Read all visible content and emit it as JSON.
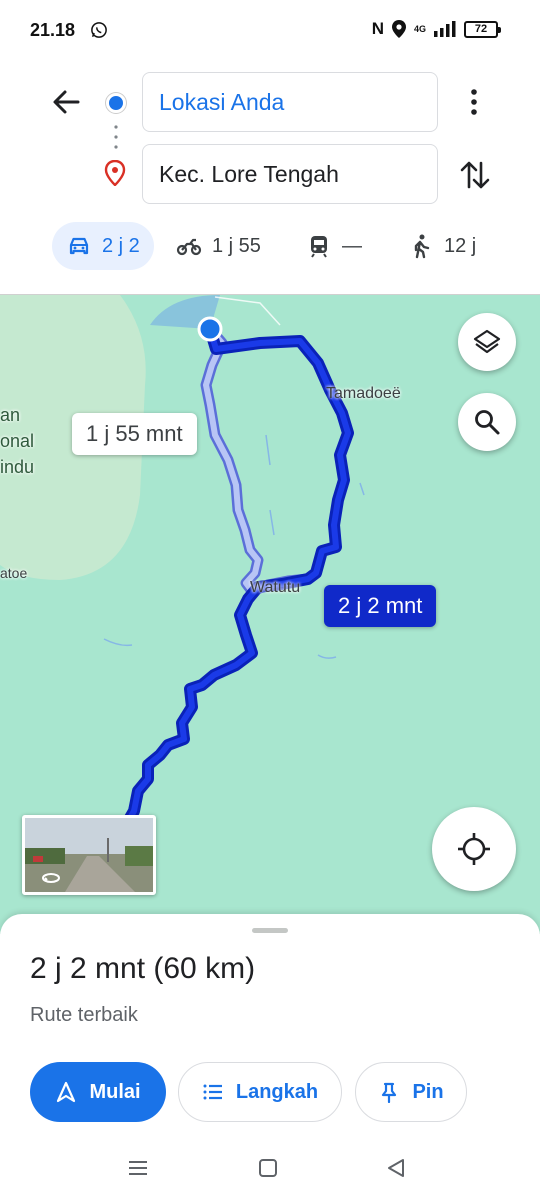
{
  "status_bar": {
    "time": "21.18",
    "network": "4G",
    "battery": "72"
  },
  "directions": {
    "origin_value": "Lokasi Anda",
    "destination_value": "Kec. Lore Tengah"
  },
  "modes": [
    {
      "name": "car",
      "value": "2 j 2",
      "active": true
    },
    {
      "name": "motorcycle",
      "value": "1 j 55",
      "active": false
    },
    {
      "name": "transit",
      "value": "—",
      "active": false
    },
    {
      "name": "walk",
      "value": "12 j",
      "active": false
    }
  ],
  "map": {
    "labels": {
      "tamadoee": "Tamadoeë",
      "watutu": "Watutu",
      "park_line1": "an",
      "park_line2": "onal",
      "park_line3": "indu",
      "atoe": "atoe"
    },
    "alt_route_time": "1 j 55 mnt",
    "main_route_time": "2 j 2 mnt"
  },
  "summary": {
    "title": "2 j 2 mnt (60 km)",
    "subtitle": "Rute terbaik",
    "start_label": "Mulai",
    "steps_label": "Langkah",
    "pin_label": "Pin"
  },
  "colors": {
    "accent": "#1a73e8",
    "route_main": "#1029c9",
    "route_alt": "#a8b8f0",
    "map_green": "#a8e6cf"
  }
}
